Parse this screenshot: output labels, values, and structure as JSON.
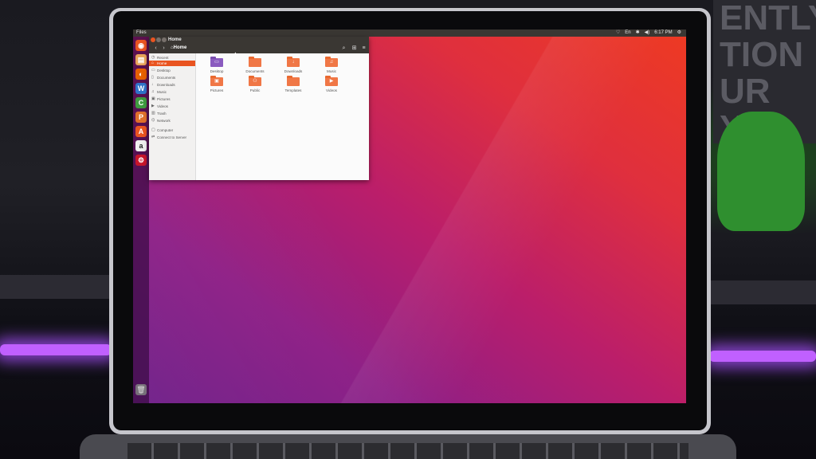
{
  "topbar": {
    "app_name": "Files",
    "indicators": [
      {
        "name": "wifi-icon",
        "glyph": "♡"
      },
      {
        "name": "keyboard-layout",
        "glyph": "En"
      },
      {
        "name": "bluetooth-icon",
        "glyph": "✱"
      },
      {
        "name": "volume-icon",
        "glyph": "◀)"
      },
      {
        "name": "clock",
        "glyph": "6:17 PM"
      },
      {
        "name": "gear-icon",
        "glyph": "⚙"
      }
    ]
  },
  "launcher": [
    {
      "name": "dash-icon",
      "glyph": "◉",
      "color": "#e95420"
    },
    {
      "name": "files-icon",
      "glyph": "▤",
      "color": "#e8a45a"
    },
    {
      "name": "firefox-icon",
      "glyph": "◐",
      "color": "#e66000"
    },
    {
      "name": "writer-icon",
      "glyph": "W",
      "color": "#2f73c9"
    },
    {
      "name": "calc-icon",
      "glyph": "C",
      "color": "#3f9b3f"
    },
    {
      "name": "impress-icon",
      "glyph": "P",
      "color": "#e0702a"
    },
    {
      "name": "software-center-icon",
      "glyph": "A",
      "color": "#e95420"
    },
    {
      "name": "amazon-icon",
      "glyph": "a",
      "color": "#efefef"
    },
    {
      "name": "settings-icon",
      "glyph": "⚙",
      "color": "#c7162b"
    }
  ],
  "window": {
    "title": "Home",
    "path": "⌂Home"
  },
  "sidebar": {
    "items": [
      {
        "label": "Recent",
        "icon": "◷",
        "icon_name": "recent-icon"
      },
      {
        "label": "Home",
        "icon": "⌂",
        "icon_name": "home-icon",
        "active": true
      },
      {
        "label": "Desktop",
        "icon": "▭",
        "icon_name": "desktop-icon"
      },
      {
        "label": "Documents",
        "icon": "▯",
        "icon_name": "documents-icon"
      },
      {
        "label": "Downloads",
        "icon": "↓",
        "icon_name": "downloads-icon"
      },
      {
        "label": "Music",
        "icon": "♫",
        "icon_name": "music-icon"
      },
      {
        "label": "Pictures",
        "icon": "▣",
        "icon_name": "pictures-icon"
      },
      {
        "label": "Videos",
        "icon": "▶",
        "icon_name": "videos-icon"
      },
      {
        "label": "Trash",
        "icon": "▥",
        "icon_name": "trash-icon"
      },
      {
        "label": "Network",
        "icon": "⌬",
        "icon_name": "network-icon"
      },
      {
        "label": "Computer",
        "icon": "▢",
        "icon_name": "computer-icon"
      },
      {
        "label": "Connect to Server",
        "icon": "⇄",
        "icon_name": "connect-server-icon"
      }
    ]
  },
  "folders": [
    {
      "label": "Desktop",
      "glyph": "▭",
      "icon_name": "desktop-folder-icon"
    },
    {
      "label": "Documents",
      "glyph": "",
      "icon_name": "documents-folder-icon"
    },
    {
      "label": "Downloads",
      "glyph": "↓",
      "icon_name": "downloads-folder-icon"
    },
    {
      "label": "Music",
      "glyph": "♫",
      "icon_name": "music-folder-icon"
    },
    {
      "label": "Pictures",
      "glyph": "▣",
      "icon_name": "pictures-folder-icon"
    },
    {
      "label": "Public",
      "glyph": "⚇",
      "icon_name": "public-folder-icon"
    },
    {
      "label": "Templates",
      "glyph": "",
      "icon_name": "templates-folder-icon"
    },
    {
      "label": "Videos",
      "glyph": "▶",
      "icon_name": "videos-folder-icon"
    }
  ],
  "toolbar": {
    "back": "‹",
    "forward": "›",
    "search": "⌕",
    "view": "⊞",
    "menu": "≡"
  },
  "trash_glyph": "🗑"
}
